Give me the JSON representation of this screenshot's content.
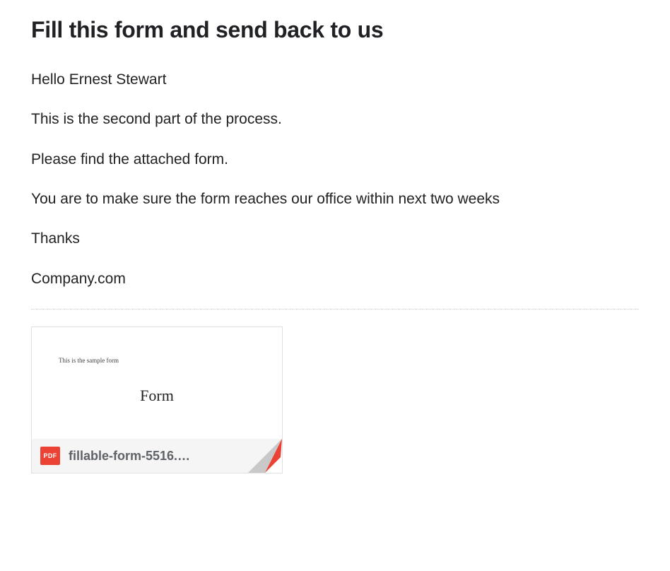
{
  "subject": "Fill this form and send back to us",
  "body": {
    "greeting": "Hello Ernest Stewart",
    "line1": "This is the second part of the process.",
    "line2": "Please find the attached form.",
    "line3": "You are to make sure the form reaches our office within next two weeks",
    "thanks": "Thanks",
    "signature": "Company.com"
  },
  "attachment": {
    "preview_small_text": "This is the sample form",
    "preview_title": "Form",
    "badge_label": "PDF",
    "filename": "fillable-form-5516.…"
  }
}
